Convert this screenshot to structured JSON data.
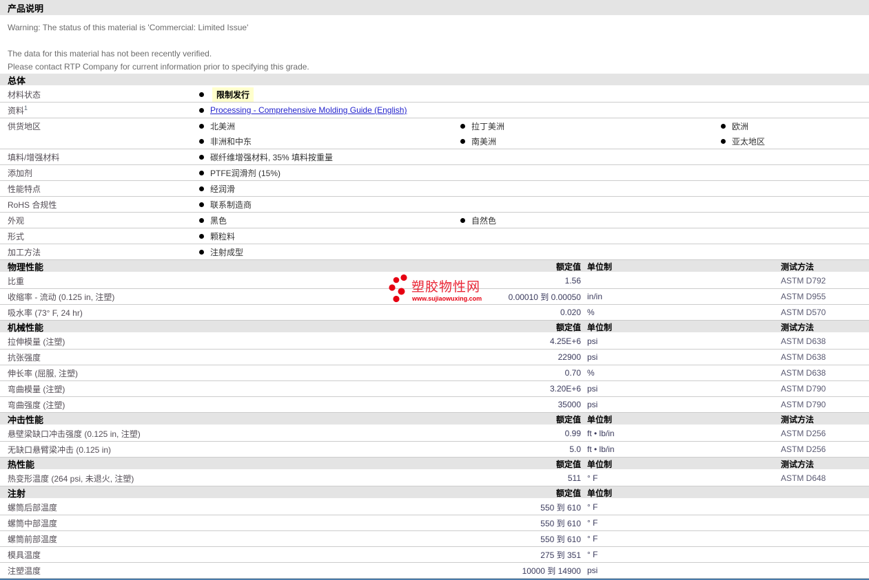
{
  "header": {
    "title": "产品说明"
  },
  "warning": {
    "line1": "Warning: The status of this material is 'Commercial: Limited Issue'",
    "line2": "The data for this material has not been recently verified.",
    "line3": "Please contact RTP Company for current information prior to specifying this grade."
  },
  "columns": {
    "value": "额定值",
    "unit": "单位制",
    "test": "测试方法"
  },
  "watermark": {
    "name": "塑胶物性网",
    "site": "www.sujiaowuxing.com"
  },
  "colors": {
    "highlight_bg": "#ffffcc",
    "link_blue": "#2323cc",
    "watermark_red": "#e60012",
    "section_header_bg": "#e4e4e4",
    "bottom_border_blue": "#4a7aa8"
  },
  "sections": [
    {
      "title": "总体",
      "kind": "bullets",
      "col_headers": false,
      "rows": [
        {
          "label": "材料状态",
          "style": "highlight",
          "lines": [
            [
              "限制发行"
            ]
          ]
        },
        {
          "label": "资料",
          "sup": "1",
          "style": "link",
          "lines": [
            [
              "Processing - Comprehensive Molding Guide (English)"
            ]
          ]
        },
        {
          "label": "供货地区",
          "lines": [
            [
              "北美洲",
              "拉丁美洲",
              "欧洲"
            ],
            [
              "非洲和中东",
              "南美洲",
              "亚太地区"
            ]
          ]
        },
        {
          "label": "填料/增强材料",
          "lines": [
            [
              "碳纤维增强材料, 35% 填料按重量"
            ]
          ]
        },
        {
          "label": "添加剂",
          "lines": [
            [
              "PTFE润滑剂  (15%)"
            ]
          ]
        },
        {
          "label": "性能特点",
          "lines": [
            [
              "经润滑"
            ]
          ]
        },
        {
          "label": "RoHS 合规性",
          "lines": [
            [
              "联系制造商"
            ]
          ]
        },
        {
          "label": "外观",
          "lines": [
            [
              "黑色",
              "自然色"
            ]
          ]
        },
        {
          "label": "形式",
          "lines": [
            [
              "颗粒料"
            ]
          ]
        },
        {
          "label": "加工方法",
          "lines": [
            [
              "注射成型"
            ]
          ]
        }
      ]
    },
    {
      "title": "物理性能",
      "kind": "values",
      "col_headers": true,
      "show_test": true,
      "rows": [
        {
          "label": "比重",
          "value": "1.56",
          "unit": "",
          "test": "ASTM D792"
        },
        {
          "label": "收缩率 - 流动  (0.125 in, 注塑)",
          "value": "0.00010 到  0.00050",
          "unit": "in/in",
          "test": "ASTM D955"
        },
        {
          "label": "吸水率  (73° F, 24 hr)",
          "value": "0.020",
          "unit": "%",
          "test": "ASTM D570"
        }
      ]
    },
    {
      "title": "机械性能",
      "kind": "values",
      "col_headers": true,
      "show_test": true,
      "rows": [
        {
          "label": "拉伸模量  (注塑)",
          "value": "4.25E+6",
          "unit": "psi",
          "test": "ASTM D638"
        },
        {
          "label": "抗张强度",
          "value": "22900",
          "unit": "psi",
          "test": "ASTM D638"
        },
        {
          "label": "伸长率  (屈服, 注塑)",
          "value": "0.70",
          "unit": "%",
          "test": "ASTM D638"
        },
        {
          "label": "弯曲模量  (注塑)",
          "value": "3.20E+6",
          "unit": "psi",
          "test": "ASTM D790"
        },
        {
          "label": "弯曲强度  (注塑)",
          "value": "35000",
          "unit": "psi",
          "test": "ASTM D790"
        }
      ]
    },
    {
      "title": "冲击性能",
      "kind": "values",
      "col_headers": true,
      "show_test": true,
      "rows": [
        {
          "label": "悬壁梁缺口冲击强度  (0.125 in, 注塑)",
          "value": "0.99",
          "unit": "ft • lb/in",
          "test": "ASTM D256"
        },
        {
          "label": "无缺口悬臂梁冲击  (0.125 in)",
          "value": "5.0",
          "unit": "ft • lb/in",
          "test": "ASTM D256"
        }
      ]
    },
    {
      "title": "热性能",
      "kind": "values",
      "col_headers": true,
      "show_test": true,
      "rows": [
        {
          "label": "热变形温度  (264 psi, 未退火, 注塑)",
          "value": "511",
          "unit": "° F",
          "test": "ASTM D648"
        }
      ]
    },
    {
      "title": "注射",
      "kind": "values",
      "col_headers": true,
      "show_test": false,
      "rows": [
        {
          "label": "螺筒后部温度",
          "value": "550 到  610",
          "unit": "° F",
          "test": ""
        },
        {
          "label": "螺筒中部温度",
          "value": "550 到  610",
          "unit": "° F",
          "test": ""
        },
        {
          "label": "螺筒前部温度",
          "value": "550 到  610",
          "unit": "° F",
          "test": ""
        },
        {
          "label": "模具温度",
          "value": "275 到  351",
          "unit": "° F",
          "test": ""
        },
        {
          "label": "注塑温度",
          "value": "10000 到  14900",
          "unit": "psi",
          "test": ""
        }
      ]
    }
  ]
}
